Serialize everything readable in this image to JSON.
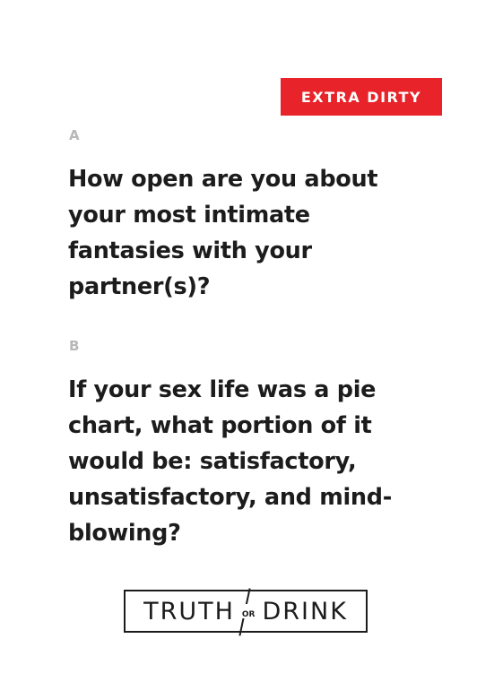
{
  "card": {
    "badge": "EXTRA DIRTY",
    "option_a_label": "A",
    "option_a_text": "How open are you about your most intimate fantasies with your partner(s)?",
    "option_b_label": "B",
    "option_b_text": "If your sex life was a pie chart, what portion of it would be: satisfactory, unsatisfactory, and mind-blowing?",
    "logo": {
      "left_word": "TRUTH",
      "middle": "OR",
      "right_word": "DRINK"
    }
  },
  "colors": {
    "badge_bg": "#e8232a",
    "text": "#1c1c1c",
    "label": "#b8b8b8"
  }
}
